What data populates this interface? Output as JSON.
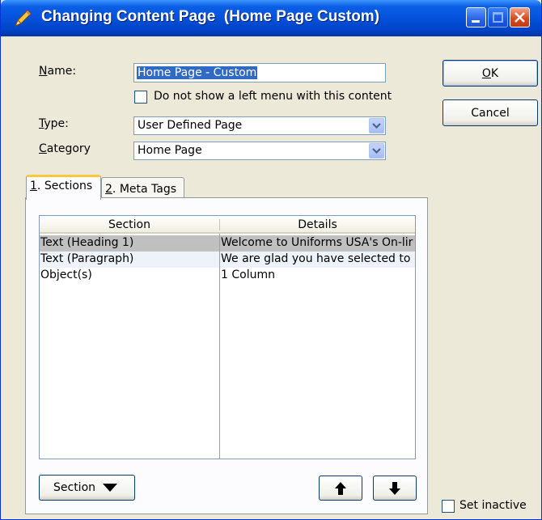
{
  "window": {
    "title": "Changing Content Page  (Home Page Custom)",
    "title_icon": "pencil-icon",
    "controls": [
      "minimize-icon",
      "maximize-icon",
      "close-icon"
    ]
  },
  "form": {
    "name_label": "Name:",
    "name_value": "Home Page - Custom",
    "no_left_menu_label": "Do not show a left menu with this content",
    "no_left_menu_checked": false,
    "type_label": "Type:",
    "type_value": "User Defined Page",
    "category_label": "Category",
    "category_value": "Home Page"
  },
  "buttons": {
    "ok": "OK",
    "cancel": "Cancel",
    "section": "Section",
    "move_up_icon": "arrow-up-icon",
    "move_down_icon": "arrow-down-icon"
  },
  "tabs": [
    {
      "label": "1. Sections",
      "active": true
    },
    {
      "label": "2. Meta Tags",
      "active": false
    }
  ],
  "list": {
    "columns": [
      "Section",
      "Details"
    ],
    "rows": [
      {
        "section": "Text (Heading 1)",
        "details": "Welcome to Uniforms USA's On-lir"
      },
      {
        "section": "Text (Paragraph)",
        "details": "We are glad you have selected to"
      },
      {
        "section": "Object(s)",
        "details": "1 Column"
      }
    ]
  },
  "footer": {
    "set_inactive_label": "Set inactive",
    "set_inactive_checked": false
  },
  "colors": {
    "titlebar": "#0551DC",
    "dialog_bg": "#ECE9D8",
    "selection": "#316AC5"
  }
}
